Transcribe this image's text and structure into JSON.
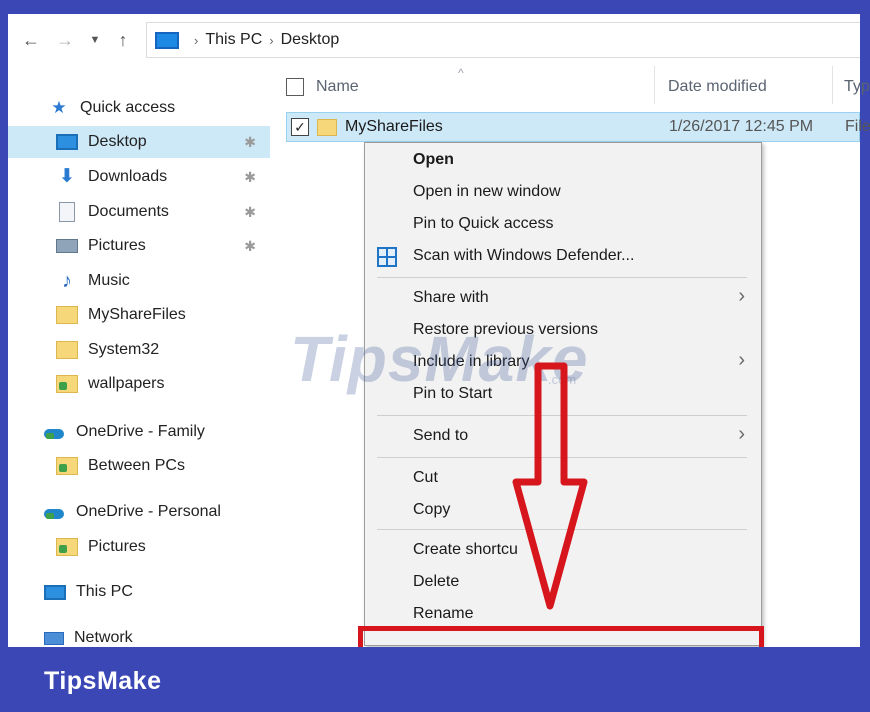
{
  "address": {
    "back_icon": "arrow-left",
    "forward_icon": "arrow-right",
    "recent_icon": "chevron-down",
    "up_icon": "arrow-up",
    "crumbs": [
      "This PC",
      "Desktop"
    ],
    "separator": "›"
  },
  "sidebar": {
    "items": [
      {
        "label": "Quick access",
        "icon": "star-icon"
      },
      {
        "label": "Desktop",
        "icon": "desktop-icon",
        "pinned": true,
        "selected": true
      },
      {
        "label": "Downloads",
        "icon": "download-icon",
        "pinned": true
      },
      {
        "label": "Documents",
        "icon": "document-icon",
        "pinned": true
      },
      {
        "label": "Pictures",
        "icon": "pictures-icon",
        "pinned": true
      },
      {
        "label": "Music",
        "icon": "music-icon"
      },
      {
        "label": "MyShareFiles",
        "icon": "folder-icon"
      },
      {
        "label": "System32",
        "icon": "folder-icon"
      },
      {
        "label": "wallpapers",
        "icon": "folder-green-icon"
      },
      {
        "label": "OneDrive - Family",
        "icon": "onedrive-icon"
      },
      {
        "label": "Between PCs",
        "icon": "folder-green-icon"
      },
      {
        "label": "OneDrive - Personal",
        "icon": "onedrive-icon"
      },
      {
        "label": "Pictures",
        "icon": "folder-green-icon"
      },
      {
        "label": "This PC",
        "icon": "computer-icon"
      },
      {
        "label": "Network",
        "icon": "network-icon"
      }
    ],
    "pin_glyph": "✱"
  },
  "list": {
    "columns": {
      "name": "Name",
      "date": "Date modified",
      "type": "Typ"
    },
    "sort_caret": "^",
    "rows": [
      {
        "name": "MyShareFiles",
        "date": "1/26/2017 12:45 PM",
        "type": "File",
        "checked": "✓"
      }
    ]
  },
  "context_menu": {
    "items": {
      "open": "Open",
      "open_new_window": "Open in new window",
      "pin_quick": "Pin to Quick access",
      "scan": "Scan with Windows Defender...",
      "share_with": "Share with",
      "restore": "Restore previous versions",
      "include_library": "Include in library",
      "pin_start": "Pin to Start",
      "send_to": "Send to",
      "cut": "Cut",
      "copy": "Copy",
      "create_shortcut": "Create shortcu",
      "delete": "Delete",
      "rename": "Rename"
    },
    "submenu_arrow": "›"
  },
  "watermark": {
    "text": "TipsMake",
    "sub": ".com"
  },
  "banner": {
    "text": "TipsMake"
  },
  "colors": {
    "frame": "#3b47b5",
    "selection": "#cde8f7",
    "highlight_red": "#d6161c"
  }
}
